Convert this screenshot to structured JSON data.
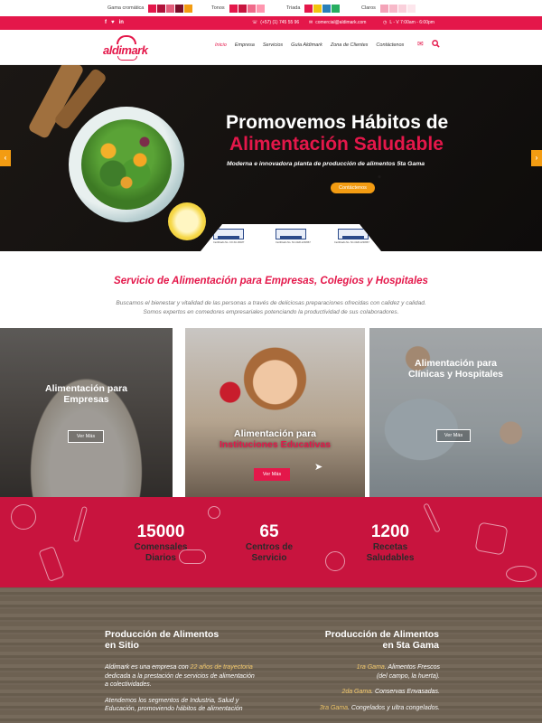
{
  "palette": {
    "groups": [
      {
        "label": "Gama cromática",
        "colors": [
          "#e4174a",
          "#b0123a",
          "#e35c7a",
          "#7a0f2a",
          "#f39c12"
        ]
      },
      {
        "label": "Tonos",
        "colors": [
          "#e4174a",
          "#c8143e",
          "#f06a8a",
          "#ff96af"
        ]
      },
      {
        "label": "Triada",
        "colors": [
          "#e4174a",
          "#f1c40f",
          "#2980b9",
          "#27ae60"
        ]
      },
      {
        "label": "Claros",
        "colors": [
          "#f4a3b8",
          "#f7b9c9",
          "#fad0db",
          "#fde6ec"
        ]
      }
    ]
  },
  "topbar": {
    "social": [
      "f",
      "♥",
      "in"
    ],
    "phone": "(+57) (1) 745 55 96",
    "email": "comercial@aldimark.com",
    "hours": "L - V 7:00am - 6:00pm"
  },
  "header": {
    "logo_text": "aldimark",
    "nav": [
      {
        "label": "Inicio",
        "active": true
      },
      {
        "label": "Empresa"
      },
      {
        "label": "Servicios"
      },
      {
        "label": "Guía Aldimark"
      },
      {
        "label": "Zona de Clientes"
      },
      {
        "label": "Contáctenos"
      }
    ],
    "icons": [
      "envelope-icon",
      "search-icon"
    ]
  },
  "hero": {
    "title_line1": "Promovemos Hábitos de",
    "title_line2": "Alimentación Saludable",
    "subtitle": "Moderna e innovadora planta de producción de alimentos 5ta Gama",
    "button": "Contáctenos",
    "certs": [
      {
        "brand": "PRODUCTS FOOD SAFETY",
        "note": "Certificado No. CO-SC-00187"
      },
      {
        "brand": "ICONTEC NORSOK",
        "note": "Certificado No. SC-CER-1234567"
      },
      {
        "brand": "ICONTEC ISO 22000",
        "note": "Certificado No. SC-CER-1234567"
      }
    ],
    "prev": "‹",
    "next": "›"
  },
  "services": {
    "title": "Servicio de Alimentación para Empresas, Colegios y Hospitales",
    "desc_line1": "Buscamos el bienestar y vitalidad de las personas a través de deliciosas preparaciones ofrecidas con calidez y calidad.",
    "desc_line2": "Somos expertos en comedores empresariales potenciando la productividad de sus colaboradores.",
    "cards": [
      {
        "title1": "Alimentación para",
        "title2": "Empresas",
        "button": "Ver Más"
      },
      {
        "title1": "Alimentación para",
        "title2": "Instituciones Educativas",
        "button": "Ver Más"
      },
      {
        "title1": "Alimentación para",
        "title2": "Clínicas y Hospitales",
        "button": "Ver Más"
      }
    ]
  },
  "stats": [
    {
      "number": "15000",
      "label1": "Comensales",
      "label2": "Diarios"
    },
    {
      "number": "65",
      "label1": "Centros de",
      "label2": "Servicio"
    },
    {
      "number": "1200",
      "label1": "Recetas",
      "label2": "Saludables"
    }
  ],
  "production": {
    "left": {
      "title1": "Producción de Alimentos",
      "title2": "en Sitio",
      "p1_a": "Aldimark es una empresa con ",
      "p1_b": "22 años de trayectoria",
      "p1_c": " dedicada a la prestación de servicios de alimentación a colectividades.",
      "p2": "Atendemos los segmentos de Industria, Salud y Educación, promoviendo hábitos de alimentación"
    },
    "right": {
      "title1": "Producción de Alimentos",
      "title2": "en 5ta Gama",
      "l1a": "1ra Gama",
      "l1b": ". Alimentos Frescos",
      "l1c": "(del campo, la huerta).",
      "l2a": "2da Gama",
      "l2b": ". Conservas Envasadas.",
      "l3a": "3ra Gama",
      "l3b": ". Congelados y ultra congelados."
    }
  }
}
